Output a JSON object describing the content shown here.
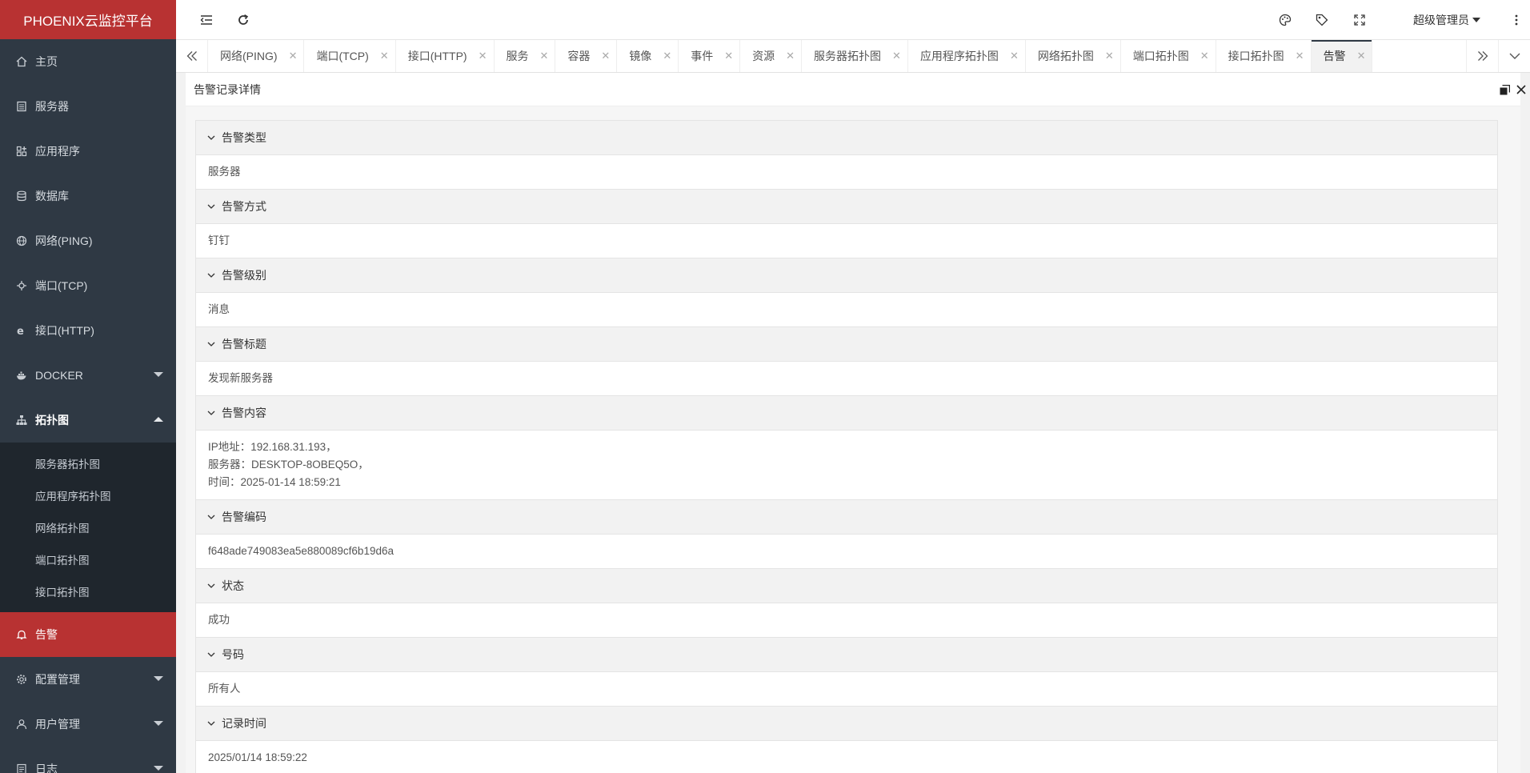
{
  "app": {
    "title": "PHOENIX云监控平台"
  },
  "sidebar": {
    "items": [
      {
        "label": "主页",
        "icon": "home-icon"
      },
      {
        "label": "服务器",
        "icon": "server-icon"
      },
      {
        "label": "应用程序",
        "icon": "apps-icon"
      },
      {
        "label": "数据库",
        "icon": "database-icon"
      },
      {
        "label": "网络(PING)",
        "icon": "globe-icon"
      },
      {
        "label": "端口(TCP)",
        "icon": "port-icon"
      },
      {
        "label": "接口(HTTP)",
        "icon": "ie-icon"
      },
      {
        "label": "DOCKER",
        "icon": "docker-icon"
      },
      {
        "label": "拓扑图",
        "icon": "sitemap-icon"
      }
    ],
    "topology_sub": [
      "服务器拓扑图",
      "应用程序拓扑图",
      "网络拓扑图",
      "端口拓扑图",
      "接口拓扑图"
    ],
    "alert": {
      "label": "告警",
      "icon": "bell-icon"
    },
    "bottom_items": [
      {
        "label": "配置管理",
        "icon": "gear-icon"
      },
      {
        "label": "用户管理",
        "icon": "user-icon"
      },
      {
        "label": "日志",
        "icon": "log-icon"
      }
    ]
  },
  "header": {
    "user": "超级管理员"
  },
  "tabs": [
    "网络(PING)",
    "端口(TCP)",
    "接口(HTTP)",
    "服务",
    "容器",
    "镜像",
    "事件",
    "资源",
    "服务器拓扑图",
    "应用程序拓扑图",
    "网络拓扑图",
    "端口拓扑图",
    "接口拓扑图",
    "告警"
  ],
  "panel": {
    "title": "告警记录详情",
    "sections": [
      {
        "title": "告警类型",
        "lines": [
          "服务器"
        ]
      },
      {
        "title": "告警方式",
        "lines": [
          "钉钉"
        ]
      },
      {
        "title": "告警级别",
        "lines": [
          "消息"
        ]
      },
      {
        "title": "告警标题",
        "lines": [
          "发现新服务器"
        ]
      },
      {
        "title": "告警内容",
        "lines": [
          "IP地址：192.168.31.193，",
          "服务器：DESKTOP-8OBEQ5O，",
          "时间：2025-01-14 18:59:21"
        ]
      },
      {
        "title": "告警编码",
        "lines": [
          "f648ade749083ea5e880089cf6b19d6a"
        ]
      },
      {
        "title": "状态",
        "lines": [
          "成功"
        ]
      },
      {
        "title": "号码",
        "lines": [
          "所有人"
        ]
      },
      {
        "title": "记录时间",
        "lines": [
          "2025/01/14 18:59:22"
        ]
      }
    ]
  }
}
